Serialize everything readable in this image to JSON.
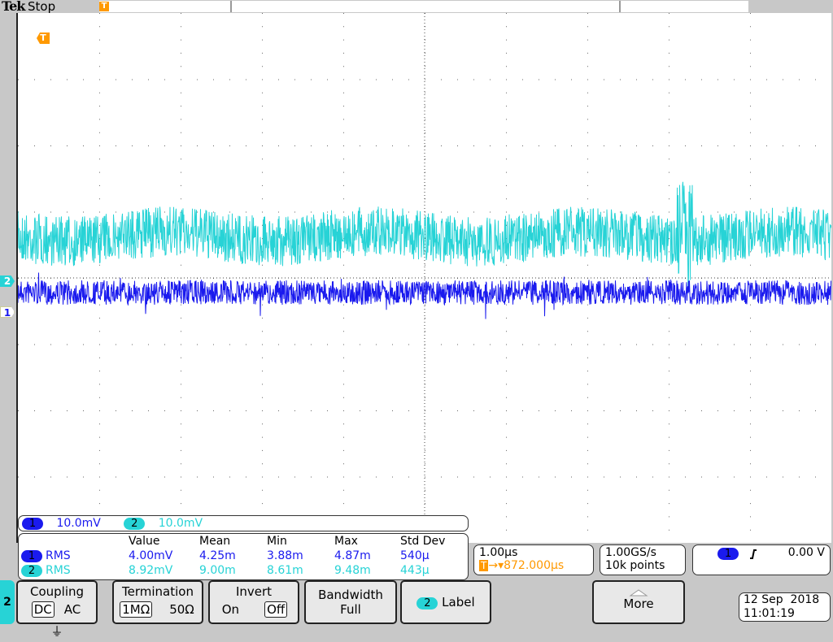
{
  "header": {
    "brand": "Tek",
    "acq_state": "Stop",
    "trigger_marker": "T"
  },
  "colors": {
    "ch1": "#1a1aee",
    "ch2": "#27d3d6",
    "trigger": "#ff9900"
  },
  "markers": {
    "ch1": "1",
    "ch2": "2",
    "trigger": "T"
  },
  "scale": {
    "ch1_label": "1",
    "ch1_scale": "10.0mV",
    "ch2_label": "2",
    "ch2_scale": "10.0mV"
  },
  "measurements": {
    "headers": [
      "Value",
      "Mean",
      "Min",
      "Max",
      "Std Dev"
    ],
    "rows": [
      {
        "ch": "1",
        "type": "RMS",
        "values": [
          "4.00mV",
          "4.25m",
          "3.88m",
          "4.87m",
          "540µ"
        ]
      },
      {
        "ch": "2",
        "type": "RMS",
        "values": [
          "8.92mV",
          "9.00m",
          "8.61m",
          "9.48m",
          "443µ"
        ]
      }
    ]
  },
  "timebase": {
    "scale": "1.00µs",
    "trig_icon": "T",
    "delay": "→▾872.000µs"
  },
  "acquisition": {
    "rate": "1.00GS/s",
    "length": "10k points"
  },
  "trigger": {
    "source": "1",
    "slope_icon": "rising-edge",
    "level": "0.00 V"
  },
  "menu": {
    "channel": "2",
    "coupling": {
      "label": "Coupling",
      "options": [
        "DC",
        "AC",
        "⏚"
      ],
      "selected": "DC"
    },
    "termination": {
      "label": "Termination",
      "options": [
        "1MΩ",
        "50Ω"
      ],
      "selected": "1MΩ"
    },
    "invert": {
      "label": "Invert",
      "options": [
        "On",
        "Off"
      ],
      "selected": "Off"
    },
    "bandwidth": {
      "label": "Bandwidth",
      "value": "Full"
    },
    "label": {
      "ch": "2",
      "label": "Label"
    },
    "more": {
      "label": "More"
    }
  },
  "datetime": {
    "date": "12 Sep  2018",
    "time": "11:01:19"
  }
}
